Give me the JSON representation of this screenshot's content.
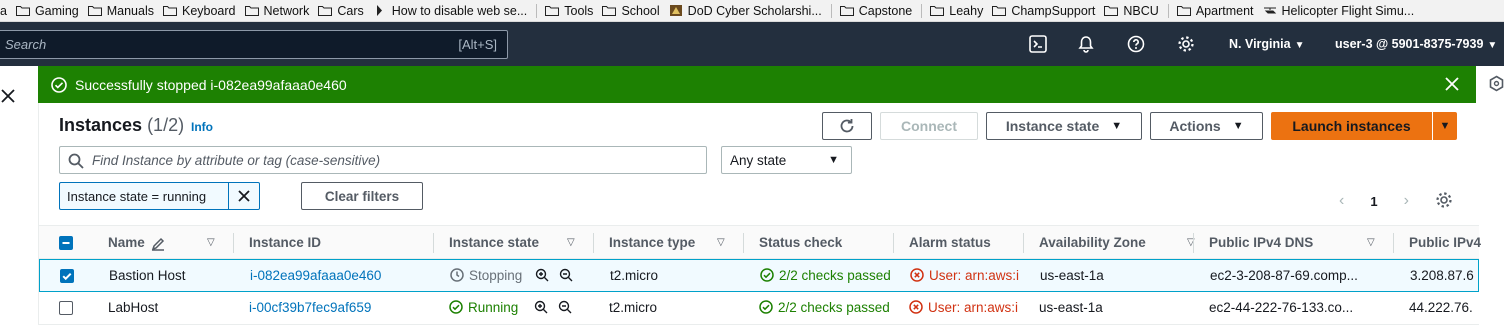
{
  "bookmarks": [
    {
      "label": "a",
      "icon": ""
    },
    {
      "label": "Gaming",
      "icon": "folder-icon"
    },
    {
      "label": "Manuals",
      "icon": "folder-icon"
    },
    {
      "label": "Keyboard",
      "icon": "folder-icon"
    },
    {
      "label": "Network",
      "icon": "folder-icon"
    },
    {
      "label": "Cars",
      "icon": "folder-icon"
    },
    {
      "label": "How to disable web se...",
      "icon": "page-icon"
    },
    {
      "label": "Tools",
      "icon": "folder-icon"
    },
    {
      "label": "School",
      "icon": "folder-icon"
    },
    {
      "label": "DoD Cyber Scholarshi...",
      "icon": "site-icon"
    },
    {
      "label": "Capstone",
      "icon": "folder-icon"
    },
    {
      "label": "Leahy",
      "icon": "folder-icon"
    },
    {
      "label": "ChampSupport",
      "icon": "folder-icon"
    },
    {
      "label": "NBCU",
      "icon": "folder-icon"
    },
    {
      "label": "Apartment",
      "icon": "folder-icon"
    },
    {
      "label": "Helicopter Flight Simu...",
      "icon": "helicopter-icon"
    }
  ],
  "topnav": {
    "search_placeholder": "Search",
    "search_shortcut": "[Alt+S]",
    "region": "N. Virginia",
    "account": "user-3 @ 5901-8375-7939"
  },
  "flash": {
    "message": "Successfully stopped i-082ea99afaaa0e460",
    "color": "#1d8102"
  },
  "panel": {
    "title": "Instances",
    "count": "(1/2)",
    "info": "Info",
    "connect": "Connect",
    "instance_state": "Instance state",
    "actions": "Actions",
    "launch": "Launch instances",
    "filter_placeholder": "Find Instance by attribute or tag (case-sensitive)",
    "state_filter": "Any state",
    "token": "Instance state = running",
    "clear_filters": "Clear filters",
    "page": "1"
  },
  "table": {
    "columns": [
      "Name",
      "Instance ID",
      "Instance state",
      "Instance type",
      "Status check",
      "Alarm status",
      "Availability Zone",
      "Public IPv4 DNS",
      "Public IPv4"
    ],
    "rows": [
      {
        "selected": true,
        "name": "Bastion Host",
        "id": "i-082ea99afaaa0e460",
        "state": "Stopping",
        "type": "t2.micro",
        "status": "2/2 checks passed",
        "alarm": "User: arn:aws:i",
        "az": "us-east-1a",
        "dns": "ec2-3-208-87-69.comp...",
        "ipv4": "3.208.87.6"
      },
      {
        "selected": false,
        "name": "LabHost",
        "id": "i-00cf39b7fec9af659",
        "state": "Running",
        "type": "t2.micro",
        "status": "2/2 checks passed",
        "alarm": "User: arn:aws:i",
        "az": "us-east-1a",
        "dns": "ec2-44-222-76-133.co...",
        "ipv4": "44.222.76."
      }
    ]
  },
  "colors": {
    "accent": "#ec7211",
    "link": "#0073bb",
    "success": "#1d8102",
    "error": "#d13212",
    "nav": "#232f3e"
  }
}
